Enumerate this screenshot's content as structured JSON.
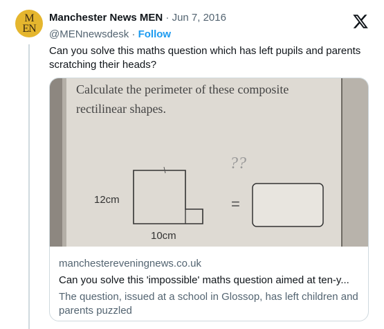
{
  "tweet": {
    "author_name": "Manchester News MEN",
    "handle": "@MENnewsdesk",
    "separator": "·",
    "date": "Jun 7, 2016",
    "follow_label": "Follow",
    "avatar_text": "M\nEN",
    "text": "Can you solve this maths question which has left pupils and parents scratching their heads?",
    "avatar_color": "#e5b62e",
    "link_color": "#1d9bf0",
    "platform_icon": "x-logo-icon"
  },
  "card": {
    "domain": "manchestereveningnews.co.uk",
    "title": "Can you solve this 'impossible' maths question aimed at ten-y...",
    "description": "The question, issued at a school in Glossop, has left children and parents puzzled",
    "image": {
      "heading_line1": "Calculate the perimeter of these composite",
      "heading_line2": "rectilinear shapes.",
      "label_height": "12cm",
      "label_width": "10cm",
      "question_marks": "??",
      "equals": "="
    }
  }
}
